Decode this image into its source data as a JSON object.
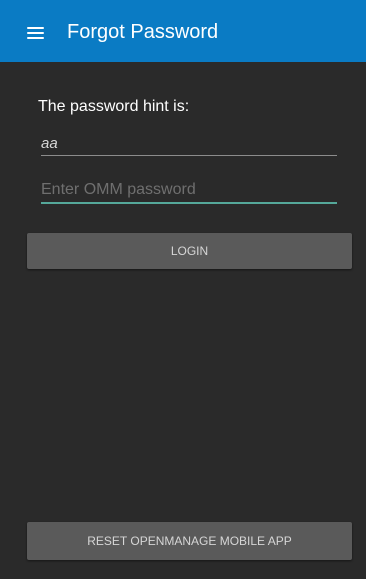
{
  "header": {
    "title": "Forgot Password",
    "menu_icon": "hamburger-menu-icon",
    "background_color": "#0a7bc4"
  },
  "hint": {
    "label": "The password hint is:",
    "value": "aa"
  },
  "password_field": {
    "value": "",
    "placeholder": "Enter OMM password",
    "focus_color": "#55a89a"
  },
  "actions": {
    "login_label": "LOGIN",
    "reset_label": "RESET OPENMANAGE MOBILE APP"
  }
}
